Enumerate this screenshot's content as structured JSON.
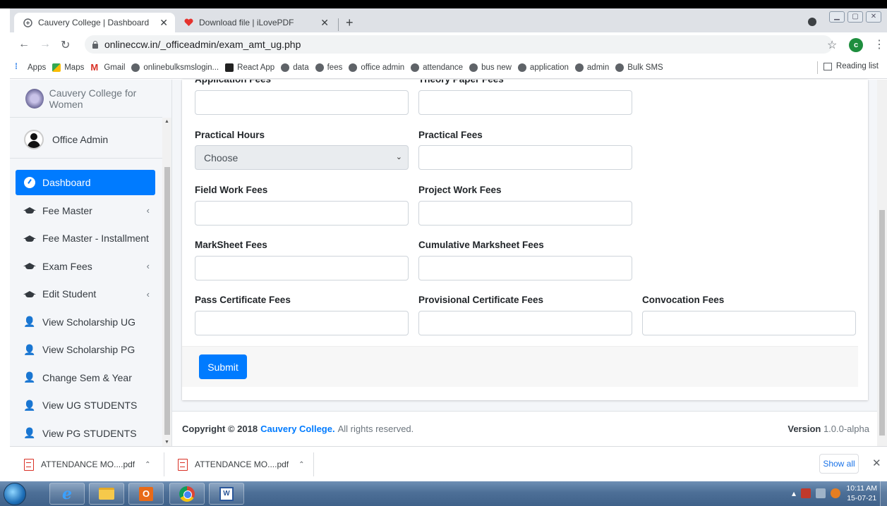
{
  "browser": {
    "tabs": [
      {
        "title": "Cauvery College | Dashboard",
        "active": true
      },
      {
        "title": "Download file | iLovePDF",
        "active": false
      }
    ],
    "new_tab": "+",
    "url": "onlineccw.in/_officeadmin/exam_amt_ug.php",
    "profile_initial": "c",
    "bookmarks": [
      "Apps",
      "Maps",
      "Gmail",
      "onlinebulksmslogin...",
      "React App",
      "data",
      "fees",
      "office admin",
      "attendance",
      "bus new",
      "application",
      "admin",
      "Bulk SMS"
    ],
    "reading_list": "Reading list"
  },
  "sidebar": {
    "brand": "Cauvery College for Women",
    "user": "Office Admin",
    "items": [
      {
        "label": "Dashboard",
        "icon": "gauge-icon",
        "active": true,
        "arrow": ""
      },
      {
        "label": "Fee Master",
        "icon": "graduation-cap-icon",
        "active": false,
        "arrow": "‹"
      },
      {
        "label": "Fee Master - Installment",
        "icon": "graduation-cap-icon",
        "active": false,
        "arrow": ""
      },
      {
        "label": "Exam Fees",
        "icon": "graduation-cap-icon",
        "active": false,
        "arrow": "‹"
      },
      {
        "label": "Edit Student",
        "icon": "graduation-cap-icon",
        "active": false,
        "arrow": "‹"
      },
      {
        "label": "View Scholarship UG",
        "icon": "user-plus-icon",
        "active": false,
        "arrow": ""
      },
      {
        "label": "View Scholarship PG",
        "icon": "user-plus-icon",
        "active": false,
        "arrow": ""
      },
      {
        "label": "Change Sem & Year",
        "icon": "user-plus-icon",
        "active": false,
        "arrow": ""
      },
      {
        "label": "View UG STUDENTS",
        "icon": "user-plus-icon",
        "active": false,
        "arrow": ""
      },
      {
        "label": "View PG STUDENTS",
        "icon": "user-plus-icon",
        "active": false,
        "arrow": ""
      }
    ]
  },
  "form": {
    "fields": {
      "application_fees": {
        "label": "Application Fees",
        "value": ""
      },
      "theory_paper_fees": {
        "label": "Theory Paper Fees",
        "value": ""
      },
      "practical_hours": {
        "label": "Practical Hours",
        "value": "Choose"
      },
      "practical_fees": {
        "label": "Practical Fees",
        "value": ""
      },
      "field_work_fees": {
        "label": "Field Work Fees",
        "value": ""
      },
      "project_work_fees": {
        "label": "Project Work Fees",
        "value": ""
      },
      "marksheet_fees": {
        "label": "MarkSheet Fees",
        "value": ""
      },
      "cumulative_marksheet_fees": {
        "label": "Cumulative Marksheet Fees",
        "value": ""
      },
      "pass_certificate_fees": {
        "label": "Pass Certificate Fees",
        "value": ""
      },
      "provisional_certificate_fees": {
        "label": "Provisional Certificate Fees",
        "value": ""
      },
      "convocation_fees": {
        "label": "Convocation Fees",
        "value": ""
      }
    },
    "submit_label": "Submit"
  },
  "footer": {
    "copyright_prefix": "Copyright © 2018 ",
    "college_link": "Cauvery College.",
    "copyright_suffix": " All rights reserved.",
    "version_label": "Version",
    "version_value": " 1.0.0-alpha"
  },
  "downloads": {
    "items": [
      "ATTENDANCE MO....pdf",
      "ATTENDANCE MO....pdf"
    ],
    "show_all": "Show all",
    "close": "✕"
  },
  "taskbar": {
    "time": "10:11 AM",
    "date": "15-07-21"
  },
  "colors": {
    "accent": "#007bff",
    "sidebar_bg": "#f4f6f9",
    "taskbar": "#4d6f97"
  }
}
